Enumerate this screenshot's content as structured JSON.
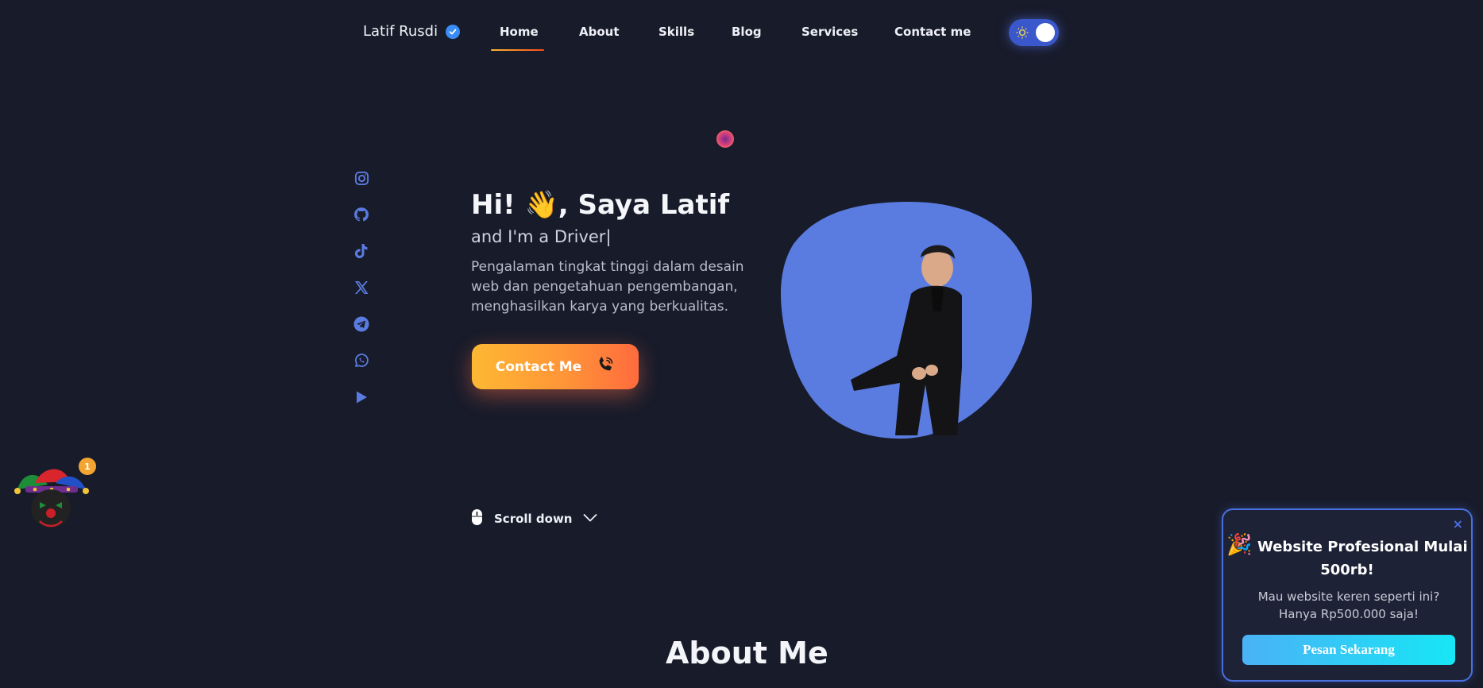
{
  "brand": {
    "name": "Latif Rusdi"
  },
  "nav": {
    "items": [
      "Home",
      "About",
      "Skills",
      "Blog",
      "Services",
      "Contact me"
    ],
    "active": "Home"
  },
  "theme_toggle": {
    "state": "on",
    "icon": "sun-icon"
  },
  "social_icons": [
    "instagram-icon",
    "github-icon",
    "tiktok-icon",
    "x-icon",
    "telegram-icon",
    "whatsapp-icon",
    "play-icon"
  ],
  "hero": {
    "title_pre": "Hi! ",
    "title_emoji": "👋",
    "title_post": ", Saya Latif",
    "subtitle": "and I'm a Driver|",
    "description": "Pengalaman tingkat tinggi dalam desain web dan pengetahuan pengembangan, menghasilkan karya yang berkualitas.",
    "cta_label": "Contact Me"
  },
  "scroll": {
    "label": "Scroll down"
  },
  "about": {
    "title": "About Me"
  },
  "mascot": {
    "badge_count": "1"
  },
  "promo": {
    "close": "×",
    "emoji": "🎉",
    "title": "Website Profesional Mulai 500rb!",
    "text": "Mau website keren seperti ini? Hanya Rp500.000 saja!",
    "button": "Pesan Sekarang"
  },
  "colors": {
    "background": "#181b2a",
    "accent_blue": "#5a7be0",
    "cta_gradient_start": "#fdb833",
    "cta_gradient_end": "#ff6b3d",
    "promo_button": "#17e6f5"
  }
}
